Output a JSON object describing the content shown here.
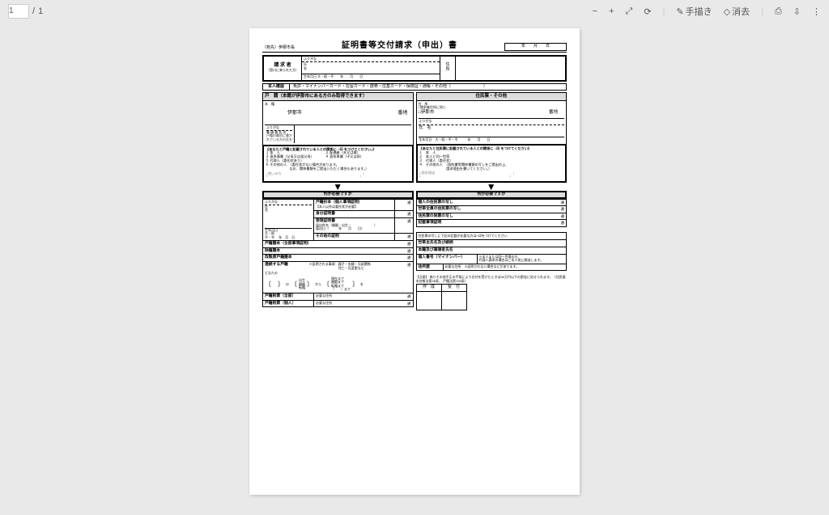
{
  "toolbar": {
    "page_current": "1",
    "page_sep": "/",
    "page_total": "1",
    "zoom_out": "−",
    "zoom_in": "+",
    "fit": "⤢",
    "rotate": "⟳",
    "lbl_draw": "手描き",
    "lbl_erase": "消去",
    "print": "⎙",
    "download": "⇩",
    "menu": "⋮"
  },
  "doc": {
    "addressee": "（宛先）伊那市長",
    "title": "証明書等交付請求（申出）書",
    "date_label": "年　　月　　日",
    "applicant_lbl1": "請 求 者",
    "applicant_lbl2": "（窓口に来られた方）",
    "furigana": "ふりがな",
    "name_lbl": "氏\n名",
    "addr_lbl": "住\n所",
    "dob_lbl": "生年月日",
    "era1": "大・昭・平",
    "ymd1": "年　　月　　日",
    "idcheck_lbl": "本人確認",
    "idcheck_val": "免許・マイナンバーカード・在留カード・旅券・住基カード・保険証・通帳・その他（　　　　　　　　）",
    "koseki_head": "戸　籍（本籍が伊那市にある方のみ取得できます）",
    "honseki_lbl": "本　籍",
    "city": "伊那市",
    "banchi": "番地",
    "hittou_lbl": "筆 頭 者 氏 名",
    "hittou_note": "戸籍の最初に書か\nれている方の氏名",
    "k_rel_hdr": "《あなたと戸籍に記載されている人との関係に ○印 をつけてください。》",
    "k_rel1": "１ 本　人",
    "k_rel2": "２ 配偶者（夫又は妻）",
    "k_rel3": "３ 直系尊属（父母又は祖父母）",
    "k_rel4": "４ 直系卑属（子又は孫）",
    "k_rel5": "５ 代理人（委任状あり）",
    "k_rel6": "６ その他の人　（委任状がない場合があります。\n　　　　　　　なお、関係書類をご提出いただく場合もあります。）",
    "usage": "使いみち",
    "need_hdr": "何が必要ですか",
    "shohon": "戸籍抄本（個人事項証明）",
    "shohon_note": "【本人以外は委任状が必要】",
    "mibun": "身分証明書",
    "juri": "受理証明書",
    "juri_note1": "届出件名（婚姻・出生・　　　　　　　）",
    "juri_note2": "届出日（　　　年　　月　　日）",
    "sonota": "その他の証明",
    "tsu": "通",
    "tohon": "戸籍謄本（全部事項証明）",
    "joseki": "除籍謄本",
    "kaisei": "改製原戸籍謄本",
    "renzoku": "連続する戸籍",
    "ren_note": "※証明される事項　親子・夫婦・兄弟関係\n　　　　　　　　　死亡・氏変更など",
    "donata": "どなたの",
    "no": "の",
    "birth": "出生",
    "marr": "婚姻",
    "trans": "転籍",
    "kara": "から",
    "now": "現在まで",
    "marr2": "婚姻まで",
    "trans2": "転籍まで",
    "til": "（　　）まで",
    "wo": "を",
    "fuhyou_all": "戸籍附票（全部）",
    "fuhyou_kojin": "戸籍附票（個人）",
    "req_addr": "必要な住所",
    "j_head": "住民票・その他",
    "addr2": "住　所",
    "same_req": "□請求者住所に同じ",
    "city2": "□伊那市",
    "name2": "氏　名",
    "dob2": "生年月日",
    "era2": "大・昭・平・令",
    "j_rel_hdr": "《あなたと住民票に記載されている人との関係に ○印 をつけてください》",
    "j_rel1": "１　本　人",
    "j_rel2": "２　本人と同一世帯",
    "j_rel3": "３　代理人（委任状）",
    "j_rel4": "４　その他の人　（契約書等関係書類の写しをご提出の上、\n　　　　　　　　請求理由を書いてください。）",
    "req_reason": "請求理由",
    "kojin_copy": "個人の住民票の写し",
    "setai_copy": "世帯全員の住民票の写し",
    "jyohyo_copy": "住民票の除票の写し",
    "kisai": "記載事項証明",
    "extra_hdr": "住民票の写しに下記の記載が必要な方は○印をつけてください",
    "setainushi": "世帯主氏名及び続柄",
    "honseki_hit": "本籍及び筆頭者氏名",
    "mynum": "個人番号（マイナンバー）",
    "mynum_note": "※本人または同一世帯の方、\n代理人請求の場合はご本人宛に郵送します。",
    "jusho_rireki": "住所歴",
    "reki_note": "必要な住所　※証明されない場合などがあります。",
    "caution": "【注意】 偽りその他不正の手段により交付を受けたときは30万円以下の罰金に処せられます。（住民基本台帳法第46条、 戸籍法第135条）",
    "sakusei": "作　成",
    "uketsuke": "受　付"
  }
}
